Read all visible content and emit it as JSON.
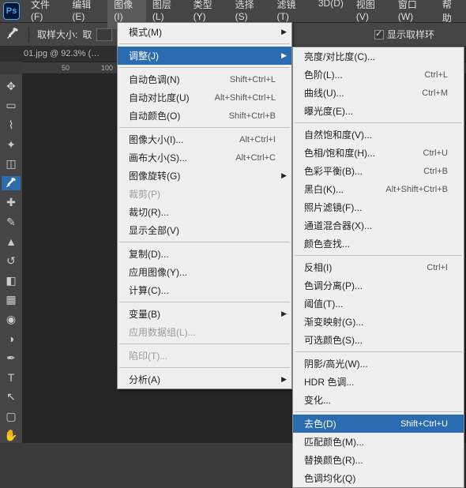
{
  "menubar": {
    "file": "文件(F)",
    "edit": "编辑(E)",
    "image": "图像(I)",
    "layer": "图层(L)",
    "type": "类型(Y)",
    "select": "选择(S)",
    "filter": "滤镜(T)",
    "3d": "3D(D)",
    "view": "视图(V)",
    "window": "窗口(W)",
    "help": "帮助"
  },
  "optionsbar": {
    "sample_size_label": "取样大小:",
    "hint_label": "取",
    "show_ring_label": "显示取样环"
  },
  "tab": {
    "title": "01.jpg @ 92.3% (…"
  },
  "ruler": {
    "t50": "50",
    "t100": "100"
  },
  "image_menu": {
    "mode": "模式(M)",
    "adjustments": "调整(J)",
    "auto_tone": {
      "label": "自动色调(N)",
      "sc": "Shift+Ctrl+L"
    },
    "auto_contrast": {
      "label": "自动对比度(U)",
      "sc": "Alt+Shift+Ctrl+L"
    },
    "auto_color": {
      "label": "自动颜色(O)",
      "sc": "Shift+Ctrl+B"
    },
    "image_size": {
      "label": "图像大小(I)...",
      "sc": "Alt+Ctrl+I"
    },
    "canvas_size": {
      "label": "画布大小(S)...",
      "sc": "Alt+Ctrl+C"
    },
    "image_rotation": "图像旋转(G)",
    "crop": "裁剪(P)",
    "trim": "裁切(R)...",
    "reveal_all": "显示全部(V)",
    "duplicate": "复制(D)...",
    "apply_image": "应用图像(Y)...",
    "calculations": "计算(C)...",
    "variables": "变量(B)",
    "apply_data_set": "应用数据组(L)...",
    "trap": "陷印(T)...",
    "analysis": "分析(A)"
  },
  "adjust_menu": {
    "brightness": "亮度/对比度(C)...",
    "levels": {
      "label": "色阶(L)...",
      "sc": "Ctrl+L"
    },
    "curves": {
      "label": "曲线(U)...",
      "sc": "Ctrl+M"
    },
    "exposure": "曝光度(E)...",
    "vibrance": "自然饱和度(V)...",
    "hue_sat": {
      "label": "色相/饱和度(H)...",
      "sc": "Ctrl+U"
    },
    "color_balance": {
      "label": "色彩平衡(B)...",
      "sc": "Ctrl+B"
    },
    "bw": {
      "label": "黑白(K)...",
      "sc": "Alt+Shift+Ctrl+B"
    },
    "photo_filter": "照片滤镜(F)...",
    "channel_mixer": "通道混合器(X)...",
    "color_lookup": "颜色查找...",
    "invert": {
      "label": "反相(I)",
      "sc": "Ctrl+I"
    },
    "posterize": "色调分离(P)...",
    "threshold": "阈值(T)...",
    "gradient_map": "渐变映射(G)...",
    "selective_color": "可选颜色(S)...",
    "shadows_highlights": "阴影/高光(W)...",
    "hdr_toning": "HDR 色调...",
    "variations": "变化...",
    "desaturate": {
      "label": "去色(D)",
      "sc": "Shift+Ctrl+U"
    },
    "match_color": "匹配颜色(M)...",
    "replace_color": "替换颜色(R)...",
    "equalize": "色调均化(Q)"
  }
}
